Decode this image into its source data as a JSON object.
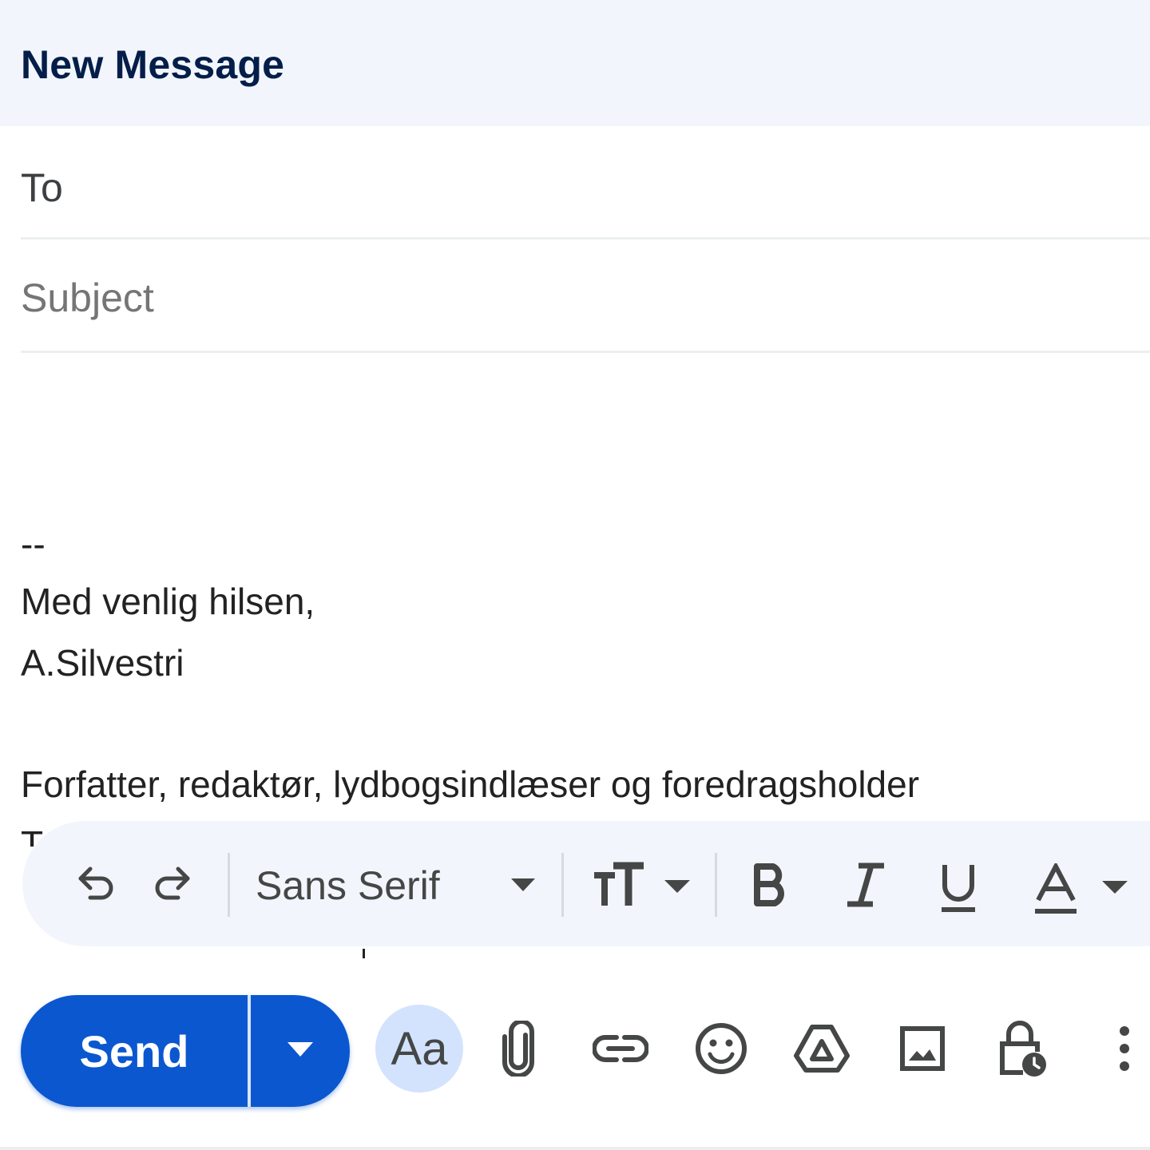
{
  "header": {
    "title": "New Message"
  },
  "fields": {
    "to_label": "To",
    "subject_placeholder": "Subject"
  },
  "signature": {
    "dash": "--",
    "greeting": "Med venlig hilsen,",
    "name": "A.Silvestri",
    "title": "Forfatter, redaktør, lydbogsindlæser og foredragsholder",
    "cut_line": "T"
  },
  "format_toolbar": {
    "font_family": "Sans Serif",
    "icons": [
      "undo-icon",
      "redo-icon",
      "font-size-icon",
      "bold-icon",
      "italic-icon",
      "underline-icon",
      "text-color-icon"
    ]
  },
  "send": {
    "label": "Send",
    "color": "#0b57d0"
  },
  "bottom_toolbar": {
    "formatting_label": "Aa",
    "icons": [
      "attach-icon",
      "link-icon",
      "emoji-icon",
      "drive-icon",
      "photo-icon",
      "confidential-lock-icon",
      "more-options-icon"
    ]
  },
  "colors": {
    "header_bg": "#f2f6fc",
    "title": "#041e49",
    "accent": "#0b57d0",
    "formatting_active_bg": "#d3e3fd"
  }
}
